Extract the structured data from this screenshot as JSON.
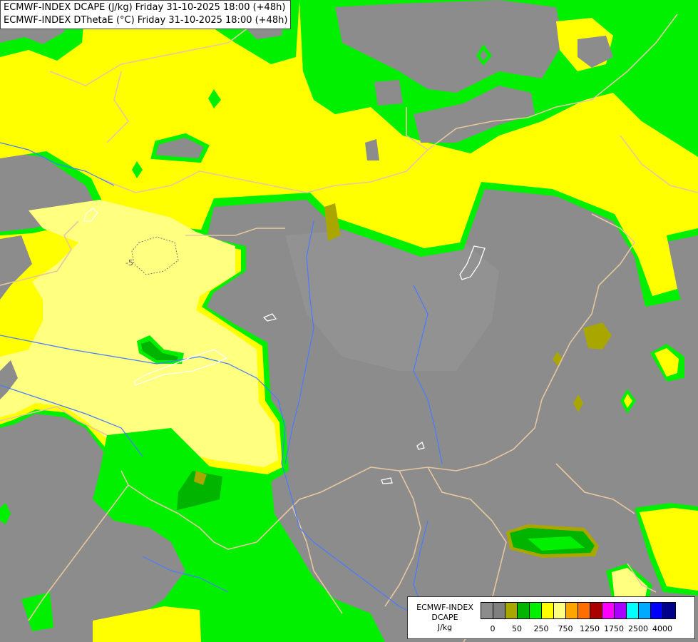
{
  "header": {
    "line1": "ECMWF-INDEX DCAPE (J/kg) Friday 31-10-2025 18:00 (+48h)",
    "line2": "ECMWF-INDEX DThetaE (°C) Friday 31-10-2025 18:00 (+48h)"
  },
  "map": {
    "contour_label": "-5"
  },
  "legend": {
    "title_line1": "ECMWF-INDEX",
    "title_line2": "DCAPE",
    "unit": "J/kg",
    "colors": [
      "#8c8c8c",
      "#7f7f7f",
      "#a9a600",
      "#00b400",
      "#00f000",
      "#ffff00",
      "#ffff80",
      "#ffa500",
      "#ff6e00",
      "#aa0000",
      "#ff00ff",
      "#aa00ff",
      "#00ffff",
      "#00aaff",
      "#0000ff",
      "#00008b"
    ],
    "ticks": [
      "0",
      "50",
      "250",
      "750",
      "1250",
      "1750",
      "2500",
      "4000"
    ]
  },
  "colors": {
    "background": "#8c8c8c",
    "border_lines": "#e6c7a0",
    "rivers": "#4a7aff"
  }
}
